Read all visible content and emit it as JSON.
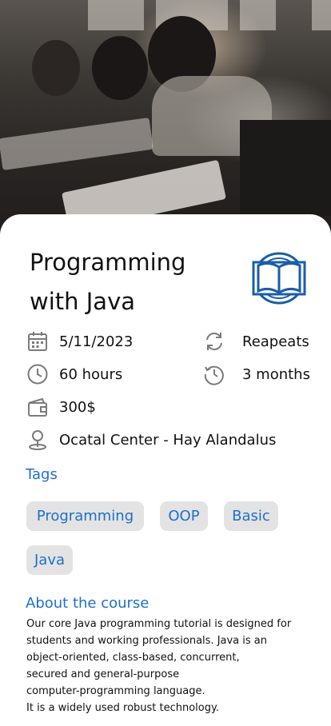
{
  "course": {
    "title_line1": "Programming",
    "title_line2": "with Java",
    "logo_icon": "open-book-logo-icon",
    "date": "5/11/2023",
    "duration": "60 hours",
    "price": "300$",
    "location": "Ocatal Center - Hay Alandalus",
    "repeats_label": "Reapeats",
    "repeat_period": "3 months"
  },
  "icons": {
    "date": "calendar-icon",
    "duration": "clock-icon",
    "price": "wallet-icon",
    "location": "location-pin-icon",
    "repeats": "refresh-icon",
    "period": "history-icon"
  },
  "tags": {
    "heading": "Tags",
    "items": [
      "Programming",
      "OOP",
      "Basic",
      "Java"
    ]
  },
  "about": {
    "heading": "About the course",
    "text": "Our core Java programming tutorial is designed for\nstudents and working professionals. Java is an\nobject-oriented, class-based, concurrent,\nsecured and general-purpose\ncomputer-programming language.\nIt is a widely used robust technology."
  },
  "colors": {
    "accent": "#1f6fc9",
    "icon_gray": "#7a7a7a",
    "tag_bg": "#e3e3e3",
    "logo_blue": "#1a5ea8"
  }
}
